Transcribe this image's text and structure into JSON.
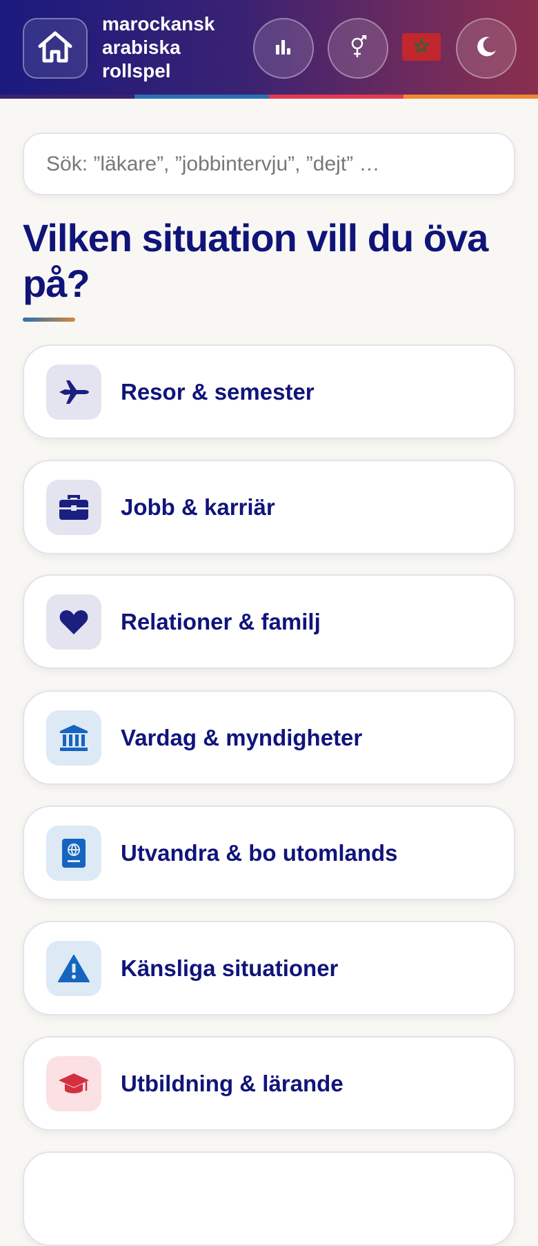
{
  "header": {
    "title_lines": [
      "marockansk",
      "arabiska",
      "rollspel"
    ],
    "stripe_colors": [
      "#3a2273",
      "#2a6fb5",
      "#e23b4f",
      "#f08a2e"
    ],
    "buttons": [
      "home-icon",
      "bar-chart-icon",
      "gender-icon",
      "flag-morocco",
      "moon-icon"
    ]
  },
  "search": {
    "placeholder": "Sök: ”läkare”, ”jobbintervju”, ”dejt” …"
  },
  "main": {
    "heading": "Vilken situation vill du öva på?",
    "categories": [
      {
        "label": "Resor & semester",
        "icon": "airplane-icon",
        "icon_color": "#1a1f80",
        "icon_bg": "#e4e4f0"
      },
      {
        "label": "Jobb & karriär",
        "icon": "briefcase-icon",
        "icon_color": "#1a1f80",
        "icon_bg": "#e4e4f0"
      },
      {
        "label": "Relationer & familj",
        "icon": "heart-icon",
        "icon_color": "#1a1f80",
        "icon_bg": "#e4e4f0"
      },
      {
        "label": "Vardag & myndigheter",
        "icon": "bank-icon",
        "icon_color": "#1565c0",
        "icon_bg": "#dde9f5"
      },
      {
        "label": "Utvandra & bo utomlands",
        "icon": "passport-icon",
        "icon_color": "#1565c0",
        "icon_bg": "#dde9f5"
      },
      {
        "label": "Känsliga situationer",
        "icon": "warning-icon",
        "icon_color": "#1565c0",
        "icon_bg": "#dde9f5"
      },
      {
        "label": "Utbildning & lärande",
        "icon": "graduation-cap-icon",
        "icon_color": "#d32f3f",
        "icon_bg": "#fbe1e4"
      }
    ]
  }
}
